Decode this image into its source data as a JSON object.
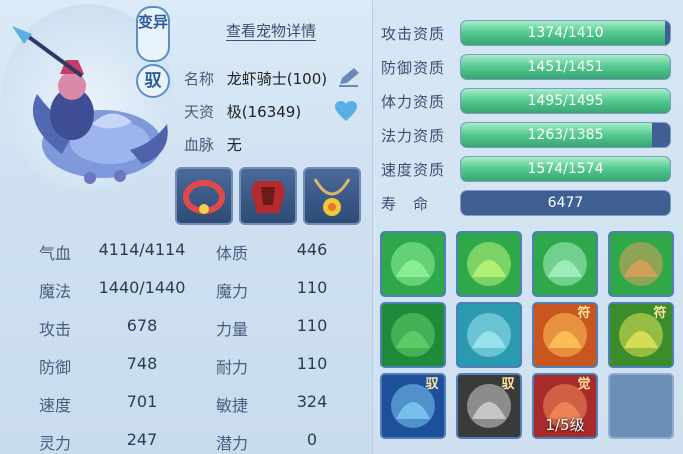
{
  "pet": {
    "badge_top": "变异",
    "badge_bottom": "驭",
    "detail_link": "查看宠物详情",
    "name_label": "名称",
    "name_value": "龙虾骑士(100)",
    "talent_label": "天资",
    "talent_value": "极(16349)",
    "bloodline_label": "血脉",
    "bloodline_value": "无"
  },
  "equipment": [
    {
      "icon": "collar-icon"
    },
    {
      "icon": "armor-icon"
    },
    {
      "icon": "amulet-icon"
    }
  ],
  "stats": [
    {
      "label": "气血",
      "value": "4114/4114",
      "label2": "体质",
      "value2": "446"
    },
    {
      "label": "魔法",
      "value": "1440/1440",
      "label2": "魔力",
      "value2": "110"
    },
    {
      "label": "攻击",
      "value": "678",
      "label2": "力量",
      "value2": "110"
    },
    {
      "label": "防御",
      "value": "748",
      "label2": "耐力",
      "value2": "110"
    },
    {
      "label": "速度",
      "value": "701",
      "label2": "敏捷",
      "value2": "324"
    },
    {
      "label": "灵力",
      "value": "247",
      "label2": "潜力",
      "value2": "0"
    }
  ],
  "aptitudes": [
    {
      "label": "攻击资质",
      "text": "1374/1410",
      "fill": 0.9745
    },
    {
      "label": "防御资质",
      "text": "1451/1451",
      "fill": 1.0
    },
    {
      "label": "体力资质",
      "text": "1495/1495",
      "fill": 1.0
    },
    {
      "label": "法力资质",
      "text": "1263/1385",
      "fill": 0.9119
    },
    {
      "label": "速度资质",
      "text": "1574/1574",
      "fill": 1.0
    }
  ],
  "lifespan": {
    "label": "寿　命",
    "value": "6477"
  },
  "skills": [
    {
      "icon": "white-wings-icon",
      "tag": ""
    },
    {
      "icon": "heart-wings-icon",
      "tag": ""
    },
    {
      "icon": "green-swirl-icon",
      "tag": ""
    },
    {
      "icon": "boot-icon",
      "tag": ""
    },
    {
      "icon": "horse-kick-icon",
      "tag": ""
    },
    {
      "icon": "water-hand-icon",
      "tag": ""
    },
    {
      "icon": "fire-figure-icon",
      "tag": "符"
    },
    {
      "icon": "green-shield-icon",
      "tag": "符"
    },
    {
      "icon": "blue-shield-icon",
      "tag": "驭"
    },
    {
      "icon": "silver-shield-icon",
      "tag": "驭"
    },
    {
      "icon": "red-warrior-icon",
      "tag": "觉",
      "level": "1/5级"
    },
    {
      "icon": "empty-slot-icon",
      "tag": ""
    }
  ]
}
